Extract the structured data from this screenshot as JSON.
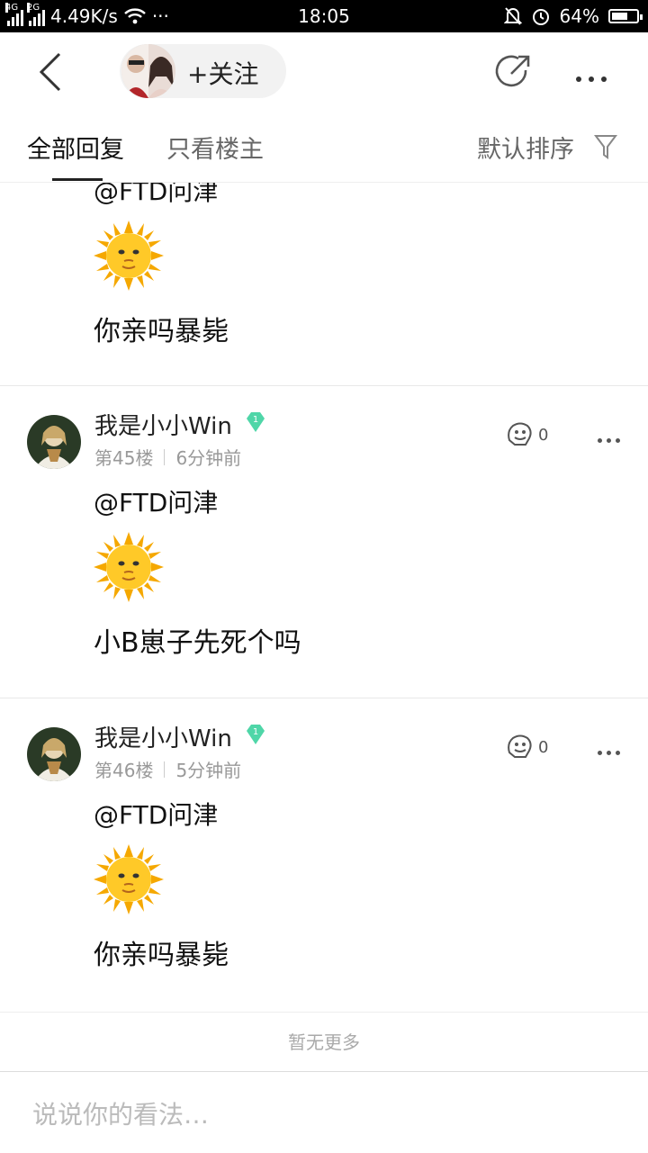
{
  "status_bar": {
    "net1": "4G",
    "net2": "2G",
    "speed": "4.49K/s",
    "time": "18:05",
    "battery": "64%",
    "battery_level": 0.64
  },
  "nav": {
    "follow_label": "+关注"
  },
  "tabs": {
    "all": "全部回复",
    "op_only": "只看楼主",
    "sort": "默认排序"
  },
  "partial_post": {
    "mention": "@FTD问津",
    "text": "你亲吗暴毙"
  },
  "posts": [
    {
      "username": "我是小小Win",
      "badge_level": "1",
      "floor": "第45楼",
      "time": "6分钟前",
      "likes": "0",
      "mention": "@FTD问津",
      "text": "小B崽子先死个吗"
    },
    {
      "username": "我是小小Win",
      "badge_level": "1",
      "floor": "第46楼",
      "time": "5分钟前",
      "likes": "0",
      "mention": "@FTD问津",
      "text": "你亲吗暴毙"
    }
  ],
  "footer": {
    "no_more": "暂无更多",
    "input_placeholder": "说说你的看法…"
  },
  "colors": {
    "badge": "#4fd6a8",
    "sun": "#f7b500"
  }
}
